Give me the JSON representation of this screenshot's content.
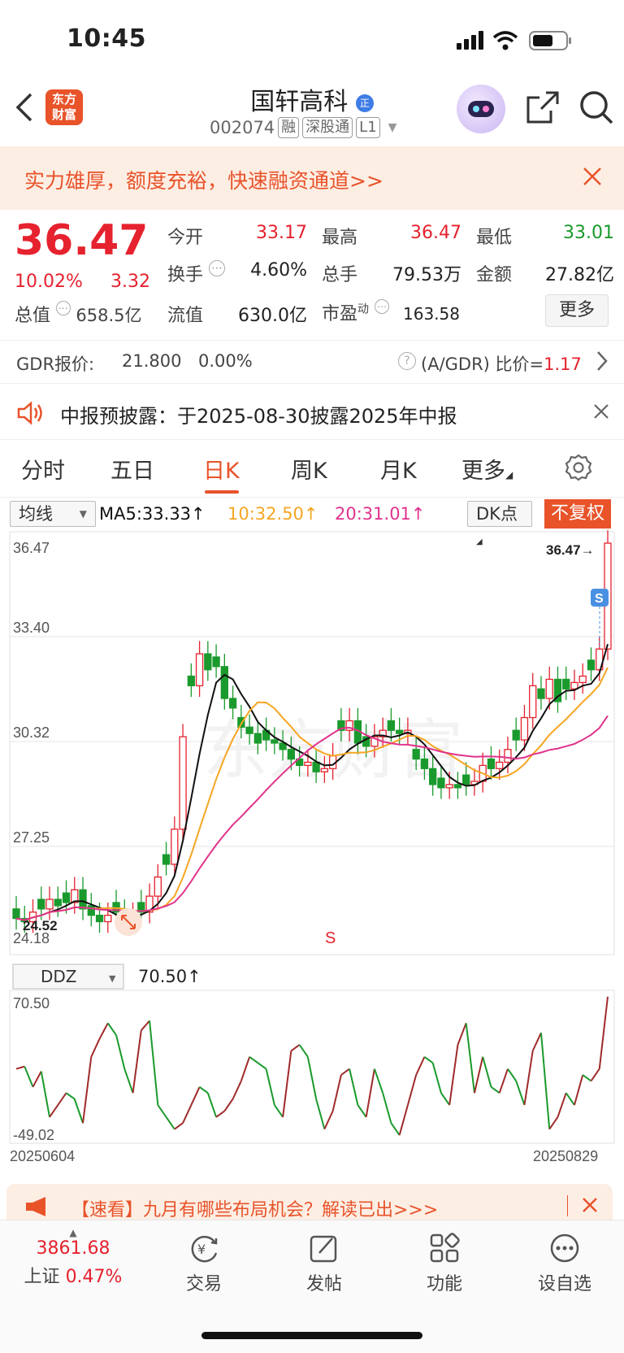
{
  "status": {
    "time": "10:45"
  },
  "header": {
    "stock_name": "国轩高科",
    "name_badge": "正",
    "code": "002074",
    "tags": [
      "融",
      "深股通",
      "L1"
    ],
    "logo_line1": "东方",
    "logo_line2": "财富"
  },
  "banner": {
    "text": "实力雄厚，额度充裕，快速融资通道>>"
  },
  "quote": {
    "price": "36.47",
    "change_pct": "10.02%",
    "change": "3.32",
    "fields": [
      {
        "label": "今开",
        "value": "33.17",
        "color": "red"
      },
      {
        "label": "最高",
        "value": "36.47",
        "color": "red"
      },
      {
        "label": "最低",
        "value": "33.01",
        "color": "green"
      },
      {
        "label": "换手",
        "value": "4.60%",
        "color": "dark"
      },
      {
        "label": "总手",
        "value": "79.53万",
        "color": "dark"
      },
      {
        "label": "金额",
        "value": "27.82亿",
        "color": "dark"
      },
      {
        "label": "流值",
        "value": "630.0亿",
        "color": "dark"
      },
      {
        "label": "市盈",
        "value": "163.58",
        "color": "dark"
      }
    ],
    "total_label": "总值",
    "total_value": "658.5亿",
    "pe_sup": "动",
    "more_label": "更多"
  },
  "gdr": {
    "label": "GDR报价:",
    "price": "21.800",
    "pct": "0.00%",
    "ratio_label": "(A/GDR) 比价=",
    "ratio": "1.17"
  },
  "notice": {
    "text": "中报预披露：于2025-08-30披露2025年中报"
  },
  "tabs": [
    {
      "label": "分时",
      "active": false
    },
    {
      "label": "五日",
      "active": false
    },
    {
      "label": "日K",
      "active": true
    },
    {
      "label": "周K",
      "active": false
    },
    {
      "label": "月K",
      "active": false
    },
    {
      "label": "更多",
      "active": false
    }
  ],
  "ma_line": {
    "selector": "均线",
    "ma5": "MA5:33.33↑",
    "ma10": "10:32.50↑",
    "ma20": "20:31.01↑",
    "dk": "DK点",
    "fq": "不复权"
  },
  "chart_data": {
    "type": "candlestick",
    "y_ticks": [
      "36.47",
      "33.40",
      "30.32",
      "27.25",
      "24.18"
    ],
    "ylim": [
      24.18,
      36.47
    ],
    "last_label": "36.47→",
    "low_label": "24.52",
    "s_marker": "S",
    "indicator": {
      "selector": "DDZ",
      "value": "70.50↑",
      "max": "70.50",
      "min": "-49.02"
    },
    "x_start": "20250604",
    "x_end": "20250829",
    "colors": {
      "up": "#e5222e",
      "down": "#1a9a2c",
      "ma5": "#111111",
      "ma10": "#f5a623",
      "ma20": "#e0338c"
    }
  },
  "promo": {
    "text": "【速看】九月有哪些布局机会？解读已出>>>"
  },
  "tabbar": {
    "index_value": "3861.68",
    "index_name": "上证",
    "index_pct": "0.47%",
    "items": [
      "交易",
      "发帖",
      "功能",
      "设自选"
    ]
  }
}
